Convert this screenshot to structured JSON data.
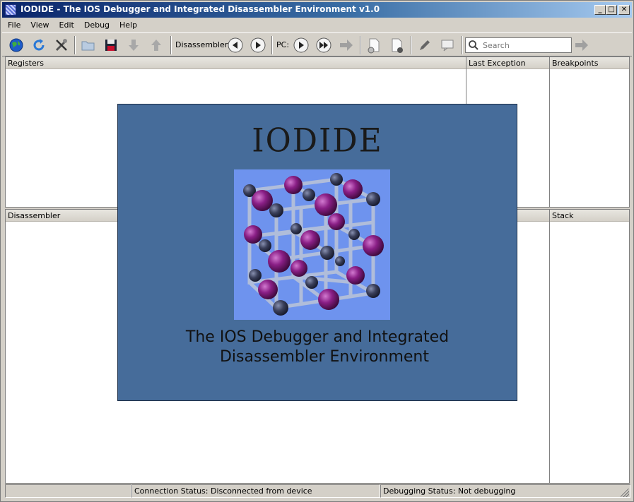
{
  "window": {
    "title": "IODIDE - The IOS Debugger and Integrated Disassembler Environment v1.0",
    "controls": {
      "minimize": "_",
      "maximize": "□",
      "close": "✕"
    }
  },
  "menu": {
    "items": [
      {
        "label": "File"
      },
      {
        "label": "View"
      },
      {
        "label": "Edit"
      },
      {
        "label": "Debug"
      },
      {
        "label": "Help"
      }
    ]
  },
  "toolbar": {
    "disassembler_label": "Disassembler:",
    "pc_label": "PC:",
    "search_placeholder": "Search",
    "icons": [
      "globe-connect-icon",
      "refresh-icon",
      "tools-icon",
      "open-folder-icon",
      "save-icon",
      "download-arrow-icon",
      "upload-arrow-icon",
      "back-icon",
      "forward-icon",
      "step-icon",
      "run-icon",
      "go-icon",
      "new-page-icon",
      "remove-page-icon",
      "pencil-icon",
      "comment-icon",
      "search-icon",
      "go-search-icon"
    ]
  },
  "panels": {
    "registers": "Registers",
    "last_exception": "Last Exception",
    "breakpoints": "Breakpoints",
    "disassembler": "Disassembler",
    "stack": "Stack"
  },
  "splash": {
    "title": "IODIDE",
    "subtitle_line1": "The IOS Debugger and Integrated",
    "subtitle_line2": "Disassembler Environment",
    "colors": {
      "background": "#466c9a",
      "logo_bg": "#6e93ee",
      "atom_purple": "#7a1a78",
      "atom_dark": "#2a2f45"
    }
  },
  "status": {
    "cell1": "",
    "connection": "Connection Status: Disconnected from device",
    "debugging": "Debugging Status: Not debugging"
  }
}
